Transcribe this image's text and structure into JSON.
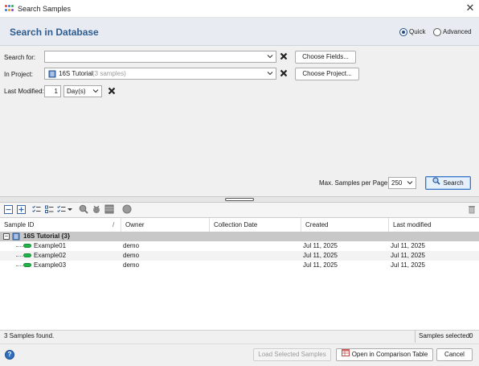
{
  "window": {
    "title": "Search Samples",
    "close_glyph": "✕"
  },
  "header": {
    "title": "Search in Database",
    "mode_quick": "Quick",
    "mode_advanced": "Advanced",
    "selected_mode": "Quick"
  },
  "form": {
    "search_for_label": "Search for:",
    "search_for_value": "",
    "choose_fields_label": "Choose Fields...",
    "in_project_label": "In Project:",
    "project_name": "16S Tutorial",
    "project_count": "(3 samples)",
    "choose_project_label": "Choose Project...",
    "last_modified_label": "Last Modified:",
    "last_modified_value": "1",
    "last_modified_unit": "Day(s)",
    "max_samples_label": "Max. Samples per Page:",
    "max_samples_value": "250",
    "search_button_label": "Search"
  },
  "table": {
    "columns": [
      "Sample ID",
      "Owner",
      "Collection Date",
      "Created",
      "Last modified"
    ],
    "sort_indicator": "/",
    "group": {
      "expand_glyph": "−",
      "label": "16S Tutorial {3}"
    },
    "rows": [
      {
        "sample_id": "Example01",
        "owner": "demo",
        "collection_date": "",
        "created": "Jul 11, 2025",
        "last_modified": "Jul 11, 2025"
      },
      {
        "sample_id": "Example02",
        "owner": "demo",
        "collection_date": "",
        "created": "Jul 11, 2025",
        "last_modified": "Jul 11, 2025"
      },
      {
        "sample_id": "Example03",
        "owner": "demo",
        "collection_date": "",
        "created": "Jul 11, 2025",
        "last_modified": "Jul 11, 2025"
      }
    ]
  },
  "status": {
    "found": "3 Samples found.",
    "selected_label": "Samples selected:",
    "selected_count": "0"
  },
  "footer": {
    "help_glyph": "?",
    "load_selected_label": "Load Selected Samples",
    "open_comparison_label": "Open in Comparison Table",
    "cancel_label": "Cancel"
  },
  "colors": {
    "header_title": "#2e5b8f",
    "header_bg": "#e8ecf2",
    "group_row_bg": "#c8c8c8",
    "sample_pill": "#22b34a"
  },
  "icons": [
    "app-icon",
    "close-icon",
    "chevron-down-icon",
    "clear-icon",
    "project-icon",
    "search-icon",
    "expand-all-icon",
    "collapse-all-icon",
    "select-all-icon",
    "select-none-icon",
    "filter-icon",
    "find-icon",
    "tools-icon",
    "table-icon",
    "trash-icon",
    "help-icon",
    "sample-icon"
  ]
}
